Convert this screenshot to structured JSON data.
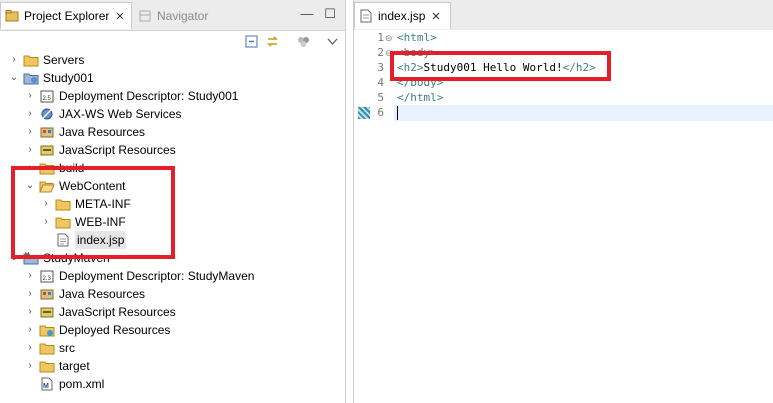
{
  "left_pane": {
    "tabs": [
      {
        "label": "Project Explorer",
        "close": "✕",
        "active": true
      },
      {
        "label": "Navigator",
        "active": false
      }
    ],
    "controls": {
      "minimize": "—",
      "maximize": "☐"
    }
  },
  "tree": {
    "items": [
      {
        "label": "Servers"
      },
      {
        "label": "Study001"
      },
      {
        "label": "Deployment Descriptor: Study001"
      },
      {
        "label": "JAX-WS Web Services"
      },
      {
        "label": "Java Resources"
      },
      {
        "label": "JavaScript Resources"
      },
      {
        "label": "build"
      },
      {
        "label": "WebContent"
      },
      {
        "label": "META-INF"
      },
      {
        "label": "WEB-INF"
      },
      {
        "label": "index.jsp"
      },
      {
        "label": "StudyMaven"
      },
      {
        "label": "Deployment Descriptor: StudyMaven"
      },
      {
        "label": "Java Resources"
      },
      {
        "label": "JavaScript Resources"
      },
      {
        "label": "Deployed Resources"
      },
      {
        "label": "src"
      },
      {
        "label": "target"
      },
      {
        "label": "pom.xml"
      }
    ]
  },
  "editor": {
    "tab": {
      "label": "index.jsp",
      "close": "✕"
    },
    "line_numbers": [
      "1",
      "2",
      "3",
      "4",
      "5",
      "6"
    ],
    "lines": [
      {
        "open": "<html>",
        "text": "",
        "close": ""
      },
      {
        "open": "<body>",
        "text": "",
        "close": ""
      },
      {
        "open": "<h2>",
        "text": "Study001 Hello World!",
        "close": "</h2>"
      },
      {
        "open": "</body>",
        "text": "",
        "close": ""
      },
      {
        "open": "</html>",
        "text": "",
        "close": ""
      },
      {
        "open": "",
        "text": "",
        "close": ""
      }
    ]
  },
  "colors": {
    "highlight": "#e3202a",
    "tag": "#3f7f7f"
  }
}
